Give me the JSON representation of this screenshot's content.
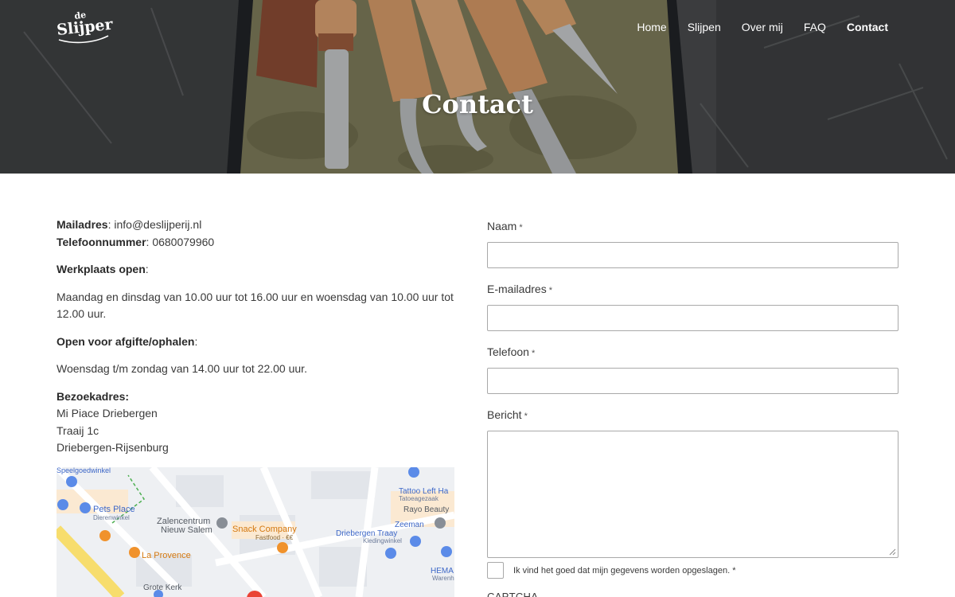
{
  "header": {
    "logo_text": "de Slijperij",
    "nav": [
      {
        "label": "Home"
      },
      {
        "label": "Slijpen"
      },
      {
        "label": "Over mij"
      },
      {
        "label": "FAQ"
      },
      {
        "label": "Contact",
        "active": true
      }
    ],
    "page_title": "Contact"
  },
  "contact": {
    "mail_label": "Mailadres",
    "mail_value": "info@deslijperij.nl",
    "phone_label": "Telefoonnummer",
    "phone_value": "0680079960",
    "workshop_label": "Werkplaats open",
    "workshop_hours": "Maandag en dinsdag van 10.00 uur tot 16.00 uur  en woensdag van 10.00 uur tot 12.00 uur.",
    "dropoff_label": "Open voor afgifte/ophalen",
    "dropoff_hours": "Woensdag t/m zondag van 14.00 uur tot 22.00 uur.",
    "address_label": "Bezoekadres:",
    "address_lines": [
      "Mi Piace Driebergen",
      "Traaij 1c",
      "Driebergen-Rijsenburg"
    ]
  },
  "map": {
    "labels": {
      "speelgoedwinkel": "Speelgoedwinkel",
      "pets_place": "Pets Place",
      "pets_place_sub": "Dierenwinkel",
      "zalencentrum_1": "Zalencentrum",
      "zalencentrum_2": "Nieuw Salem",
      "snack_company": "Snack Company",
      "snack_company_sub": "Fastfood · €€",
      "la_provence": "La Provence",
      "tattoo": "Tattoo Left Ha",
      "tattoo_sub": "Tatoeagezaak",
      "rayo": "Rayo Beauty",
      "zeeman_1": "Zeeman",
      "zeeman_2": "Driebergen Traay",
      "zeeman_sub": "Kledingwinkel",
      "hema": "HEMA",
      "hema_sub": "Warenh",
      "grote_kerk": "Grote Kerk"
    }
  },
  "form": {
    "name_label": "Naam",
    "email_label": "E-mailadres",
    "phone_label": "Telefoon",
    "message_label": "Bericht",
    "required_mark": "*",
    "consent_text": "Ik vind het goed dat mijn gegevens worden opgeslagen. *",
    "captcha_label": "CAPTCHA"
  },
  "colors": {
    "text": "#3a3a3a",
    "nav_text": "#ffffff",
    "border": "#a9a9a9",
    "map_pin_blue": "#5b8be8",
    "map_pin_orange": "#f0922c",
    "map_pin_red": "#ea4335",
    "map_road_yellow": "#f7dd6d"
  }
}
